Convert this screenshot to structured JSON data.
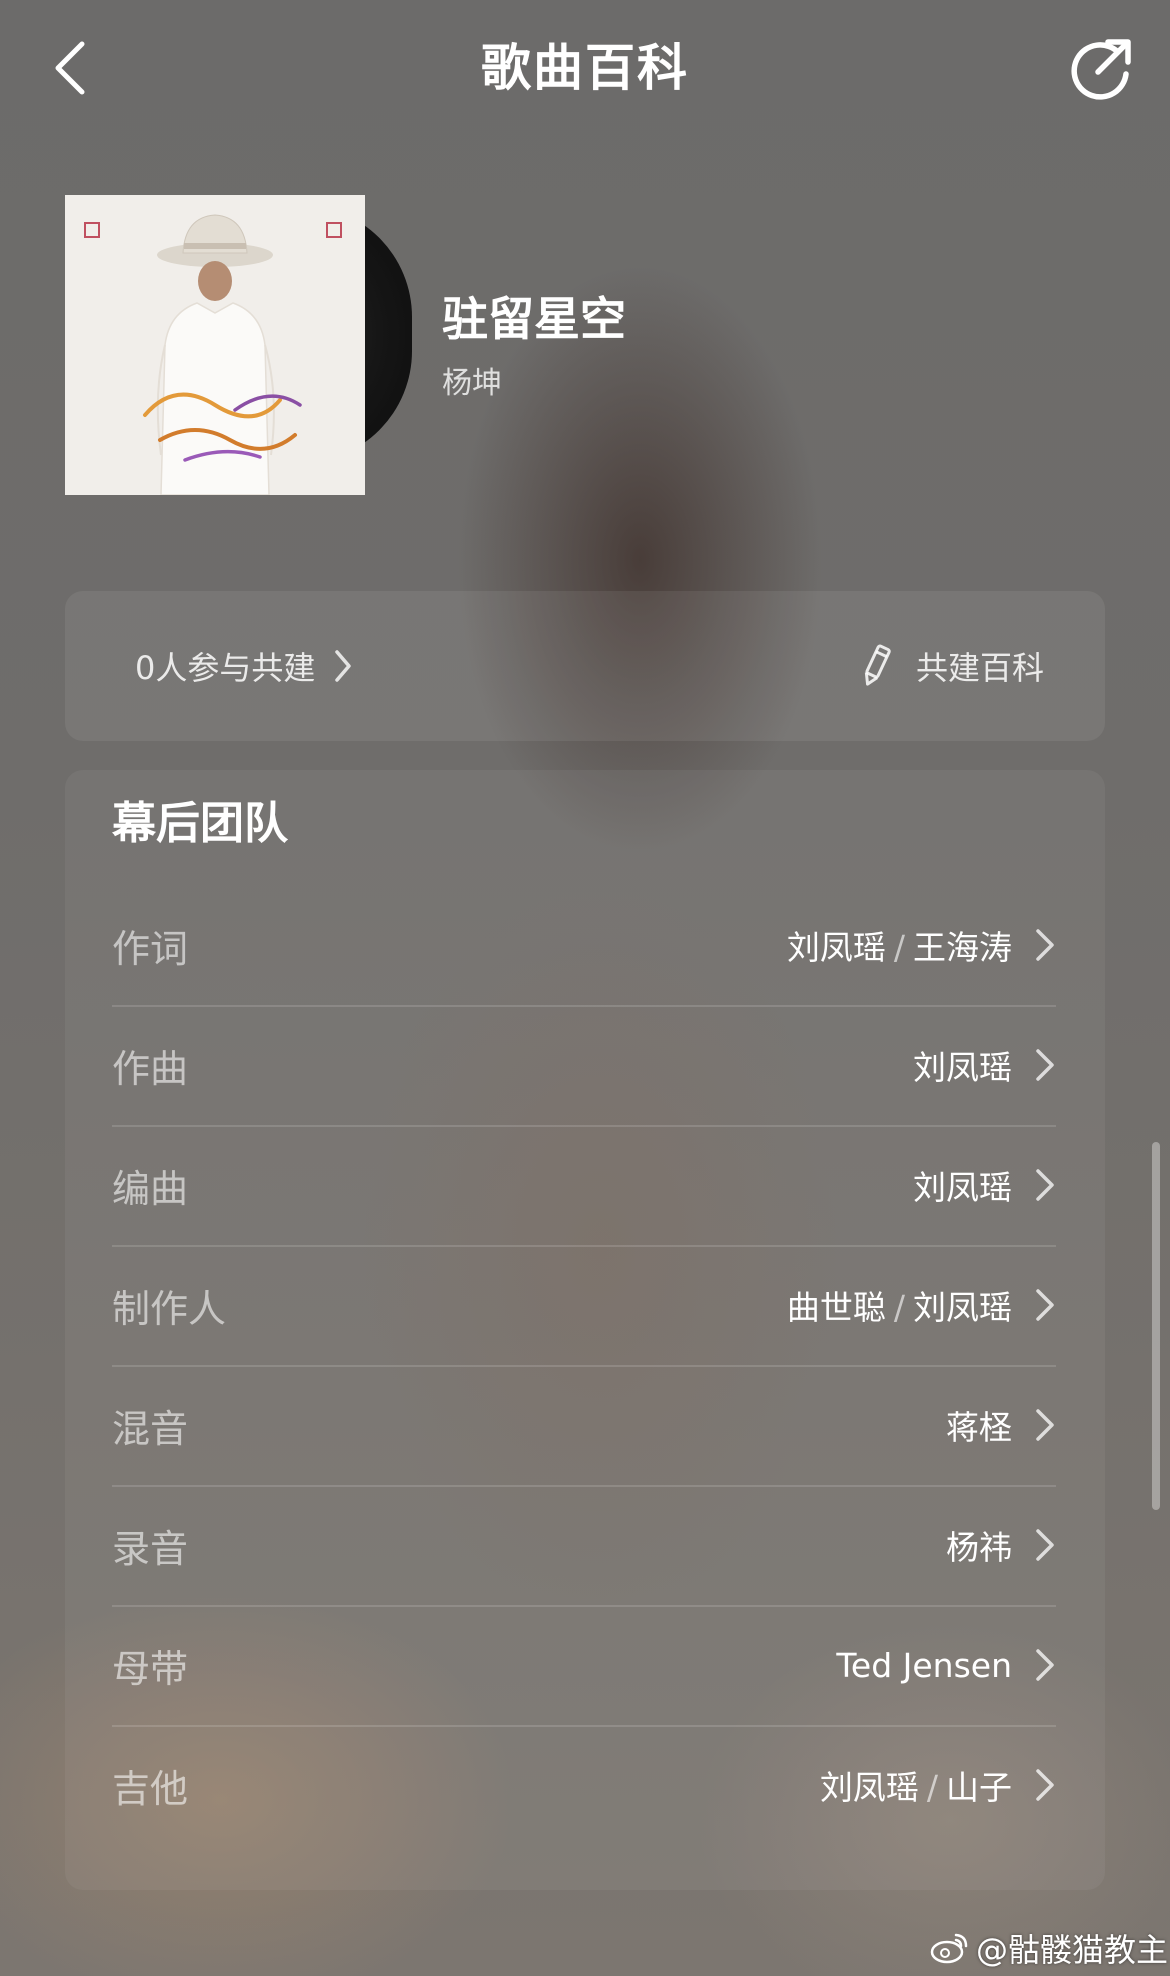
{
  "header": {
    "title": "歌曲百科"
  },
  "song": {
    "title": "驻留星空",
    "artist": "杨坤"
  },
  "cobuild": {
    "participants": "0人参与共建",
    "button_label": "共建百科"
  },
  "team": {
    "title": "幕后团队",
    "rows": [
      {
        "role": "作词",
        "names": [
          "刘凤瑶",
          "王海涛"
        ]
      },
      {
        "role": "作曲",
        "names": [
          "刘凤瑶"
        ]
      },
      {
        "role": "编曲",
        "names": [
          "刘凤瑶"
        ]
      },
      {
        "role": "制作人",
        "names": [
          "曲世聪",
          "刘凤瑶"
        ]
      },
      {
        "role": "混音",
        "names": [
          "蒋柽"
        ]
      },
      {
        "role": "录音",
        "names": [
          "杨祎"
        ]
      },
      {
        "role": "母带",
        "names": [
          "Ted Jensen"
        ]
      },
      {
        "role": "吉他",
        "names": [
          "刘凤瑶",
          "山子"
        ]
      }
    ]
  },
  "watermark": {
    "text": "@骷髅猫教主"
  },
  "icons": {
    "back": "chevron-left-icon",
    "share": "share-icon",
    "edit": "pencil-icon",
    "row_arrow": "chevron-right-icon"
  }
}
